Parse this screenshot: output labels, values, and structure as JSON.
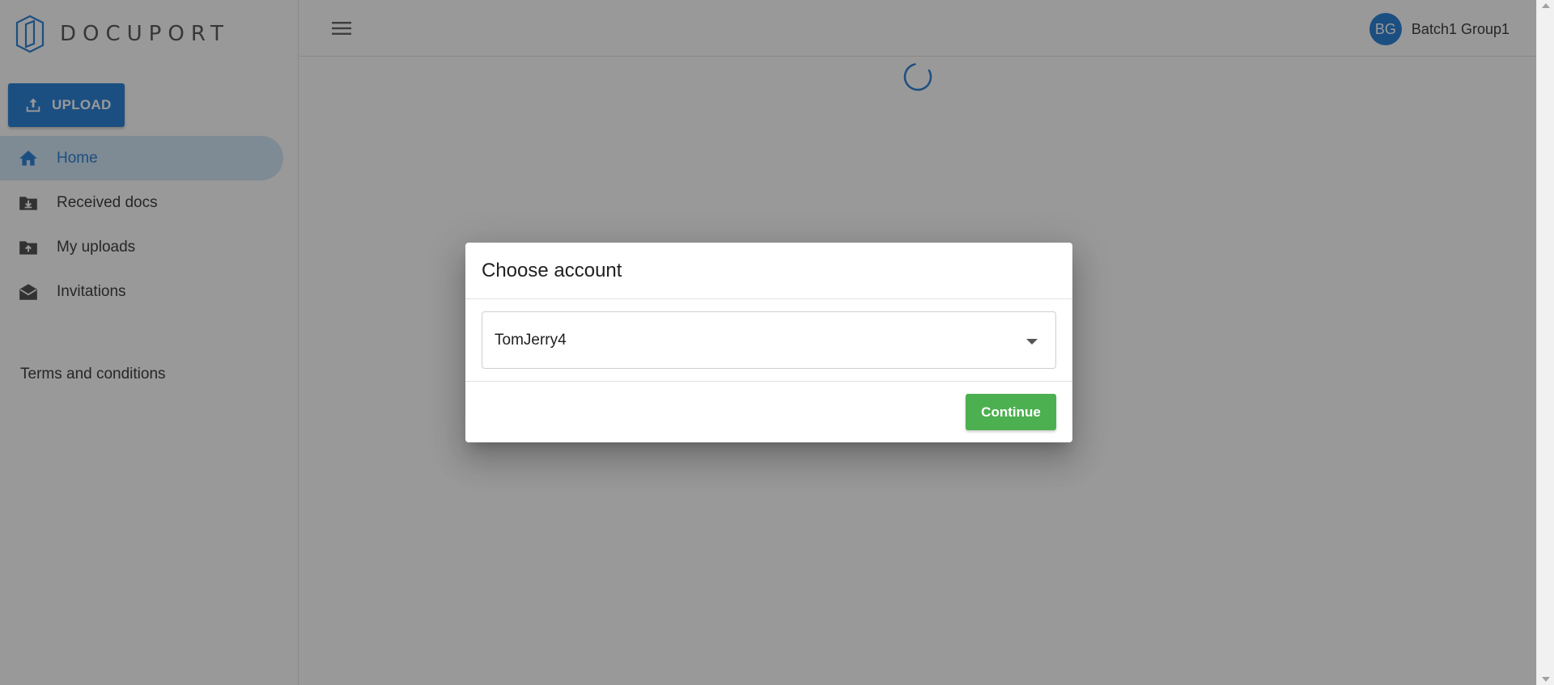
{
  "app": {
    "brand": "DOCUPORT"
  },
  "sidebar": {
    "upload_label": "UPLOAD",
    "items": [
      {
        "label": "Home",
        "icon": "home-icon",
        "active": true
      },
      {
        "label": "Received docs",
        "icon": "folder-download-icon",
        "active": false
      },
      {
        "label": "My uploads",
        "icon": "folder-upload-icon",
        "active": false
      },
      {
        "label": "Invitations",
        "icon": "envelope-open-icon",
        "active": false
      }
    ],
    "terms_label": "Terms and conditions"
  },
  "header": {
    "menu_icon": "hamburger-menu-icon",
    "user_initials": "BG",
    "user_name": "Batch1 Group1"
  },
  "dialog": {
    "title": "Choose account",
    "selected_account": "TomJerry4",
    "continue_label": "Continue"
  },
  "colors": {
    "primary": "#1976d2",
    "active_bg": "#cde3f6",
    "success": "#4caf50",
    "overlay": "rgba(33,33,33,0.46)"
  }
}
